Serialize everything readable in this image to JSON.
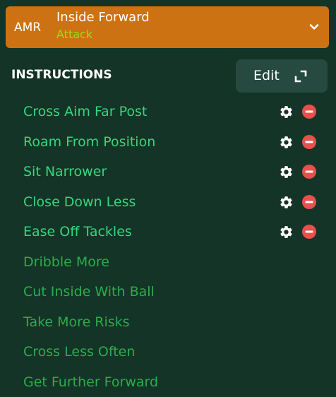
{
  "role": {
    "position": "AMR",
    "name": "Inside Forward",
    "duty": "Attack"
  },
  "instructions_section": {
    "title": "INSTRUCTIONS",
    "edit_label": "Edit"
  },
  "instructions": {
    "active": [
      "Cross Aim Far Post",
      "Roam From Position",
      "Sit Narrower",
      "Close Down Less",
      "Ease Off Tackles"
    ],
    "available": [
      "Dribble More",
      "Cut Inside With Ball",
      "Take More Risks",
      "Cross Less Often",
      "Get Further Forward"
    ]
  },
  "icons": {
    "active_row": [
      "gear-icon",
      "remove-icon"
    ],
    "header": "chevron-down-icon",
    "edit": "expand-icon"
  },
  "colors": {
    "background": "#143427",
    "header": "#cd7212",
    "duty": "#8fe21a",
    "active_text": "#39d57c",
    "available_text": "#2eab4d",
    "remove": "#e8504c",
    "edit_button": "#264a3f"
  }
}
